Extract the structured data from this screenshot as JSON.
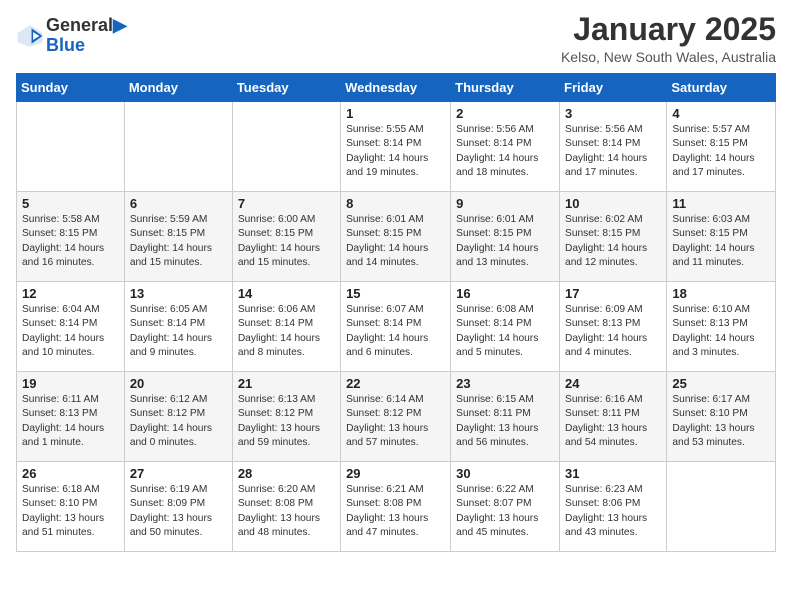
{
  "header": {
    "logo_line1": "General",
    "logo_line2": "Blue",
    "month": "January 2025",
    "location": "Kelso, New South Wales, Australia"
  },
  "weekdays": [
    "Sunday",
    "Monday",
    "Tuesday",
    "Wednesday",
    "Thursday",
    "Friday",
    "Saturday"
  ],
  "weeks": [
    [
      {
        "day": "",
        "info": ""
      },
      {
        "day": "",
        "info": ""
      },
      {
        "day": "",
        "info": ""
      },
      {
        "day": "1",
        "info": "Sunrise: 5:55 AM\nSunset: 8:14 PM\nDaylight: 14 hours\nand 19 minutes."
      },
      {
        "day": "2",
        "info": "Sunrise: 5:56 AM\nSunset: 8:14 PM\nDaylight: 14 hours\nand 18 minutes."
      },
      {
        "day": "3",
        "info": "Sunrise: 5:56 AM\nSunset: 8:14 PM\nDaylight: 14 hours\nand 17 minutes."
      },
      {
        "day": "4",
        "info": "Sunrise: 5:57 AM\nSunset: 8:15 PM\nDaylight: 14 hours\nand 17 minutes."
      }
    ],
    [
      {
        "day": "5",
        "info": "Sunrise: 5:58 AM\nSunset: 8:15 PM\nDaylight: 14 hours\nand 16 minutes."
      },
      {
        "day": "6",
        "info": "Sunrise: 5:59 AM\nSunset: 8:15 PM\nDaylight: 14 hours\nand 15 minutes."
      },
      {
        "day": "7",
        "info": "Sunrise: 6:00 AM\nSunset: 8:15 PM\nDaylight: 14 hours\nand 15 minutes."
      },
      {
        "day": "8",
        "info": "Sunrise: 6:01 AM\nSunset: 8:15 PM\nDaylight: 14 hours\nand 14 minutes."
      },
      {
        "day": "9",
        "info": "Sunrise: 6:01 AM\nSunset: 8:15 PM\nDaylight: 14 hours\nand 13 minutes."
      },
      {
        "day": "10",
        "info": "Sunrise: 6:02 AM\nSunset: 8:15 PM\nDaylight: 14 hours\nand 12 minutes."
      },
      {
        "day": "11",
        "info": "Sunrise: 6:03 AM\nSunset: 8:15 PM\nDaylight: 14 hours\nand 11 minutes."
      }
    ],
    [
      {
        "day": "12",
        "info": "Sunrise: 6:04 AM\nSunset: 8:14 PM\nDaylight: 14 hours\nand 10 minutes."
      },
      {
        "day": "13",
        "info": "Sunrise: 6:05 AM\nSunset: 8:14 PM\nDaylight: 14 hours\nand 9 minutes."
      },
      {
        "day": "14",
        "info": "Sunrise: 6:06 AM\nSunset: 8:14 PM\nDaylight: 14 hours\nand 8 minutes."
      },
      {
        "day": "15",
        "info": "Sunrise: 6:07 AM\nSunset: 8:14 PM\nDaylight: 14 hours\nand 6 minutes."
      },
      {
        "day": "16",
        "info": "Sunrise: 6:08 AM\nSunset: 8:14 PM\nDaylight: 14 hours\nand 5 minutes."
      },
      {
        "day": "17",
        "info": "Sunrise: 6:09 AM\nSunset: 8:13 PM\nDaylight: 14 hours\nand 4 minutes."
      },
      {
        "day": "18",
        "info": "Sunrise: 6:10 AM\nSunset: 8:13 PM\nDaylight: 14 hours\nand 3 minutes."
      }
    ],
    [
      {
        "day": "19",
        "info": "Sunrise: 6:11 AM\nSunset: 8:13 PM\nDaylight: 14 hours\nand 1 minute."
      },
      {
        "day": "20",
        "info": "Sunrise: 6:12 AM\nSunset: 8:12 PM\nDaylight: 14 hours\nand 0 minutes."
      },
      {
        "day": "21",
        "info": "Sunrise: 6:13 AM\nSunset: 8:12 PM\nDaylight: 13 hours\nand 59 minutes."
      },
      {
        "day": "22",
        "info": "Sunrise: 6:14 AM\nSunset: 8:12 PM\nDaylight: 13 hours\nand 57 minutes."
      },
      {
        "day": "23",
        "info": "Sunrise: 6:15 AM\nSunset: 8:11 PM\nDaylight: 13 hours\nand 56 minutes."
      },
      {
        "day": "24",
        "info": "Sunrise: 6:16 AM\nSunset: 8:11 PM\nDaylight: 13 hours\nand 54 minutes."
      },
      {
        "day": "25",
        "info": "Sunrise: 6:17 AM\nSunset: 8:10 PM\nDaylight: 13 hours\nand 53 minutes."
      }
    ],
    [
      {
        "day": "26",
        "info": "Sunrise: 6:18 AM\nSunset: 8:10 PM\nDaylight: 13 hours\nand 51 minutes."
      },
      {
        "day": "27",
        "info": "Sunrise: 6:19 AM\nSunset: 8:09 PM\nDaylight: 13 hours\nand 50 minutes."
      },
      {
        "day": "28",
        "info": "Sunrise: 6:20 AM\nSunset: 8:08 PM\nDaylight: 13 hours\nand 48 minutes."
      },
      {
        "day": "29",
        "info": "Sunrise: 6:21 AM\nSunset: 8:08 PM\nDaylight: 13 hours\nand 47 minutes."
      },
      {
        "day": "30",
        "info": "Sunrise: 6:22 AM\nSunset: 8:07 PM\nDaylight: 13 hours\nand 45 minutes."
      },
      {
        "day": "31",
        "info": "Sunrise: 6:23 AM\nSunset: 8:06 PM\nDaylight: 13 hours\nand 43 minutes."
      },
      {
        "day": "",
        "info": ""
      }
    ]
  ]
}
